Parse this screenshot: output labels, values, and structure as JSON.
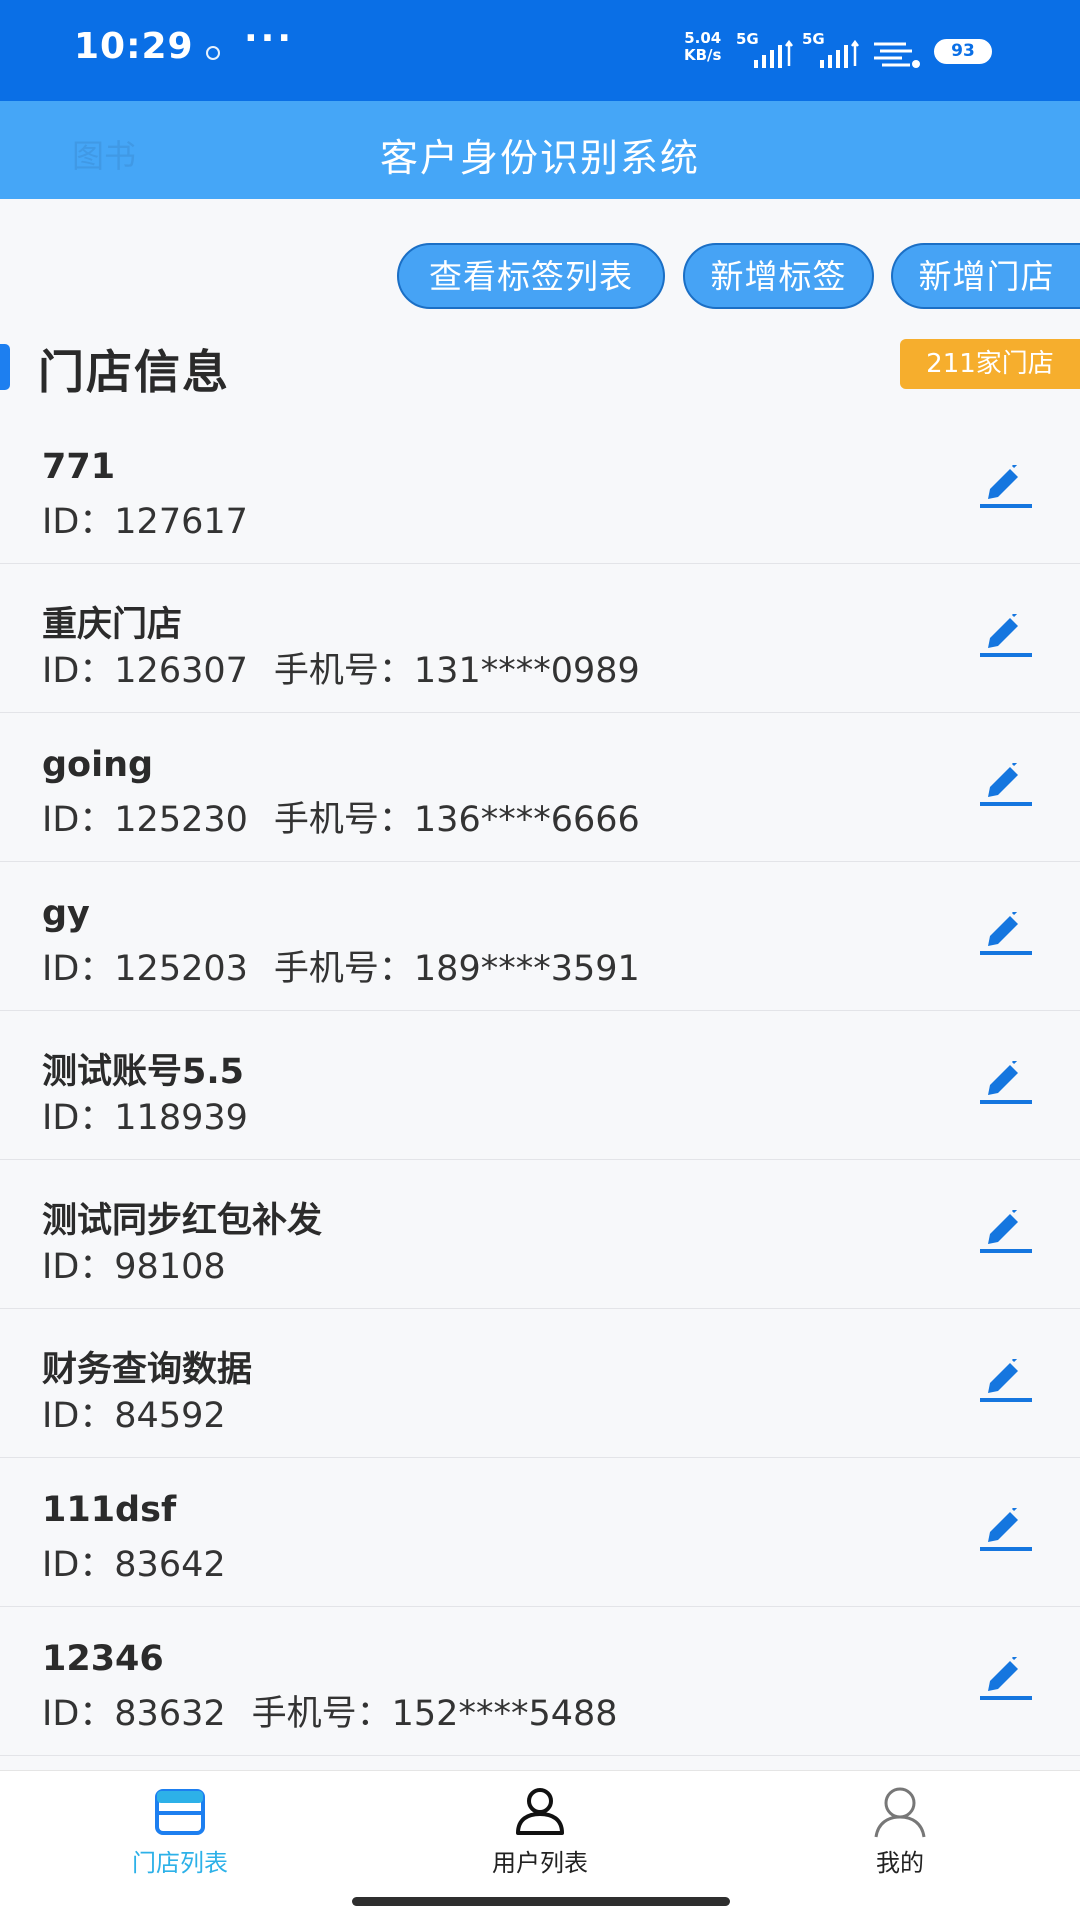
{
  "status_bar": {
    "time": "10:29",
    "more": "···",
    "speed_value": "5.04",
    "speed_unit": "KB/s",
    "signal1_label": "5G",
    "signal2_label": "5G",
    "battery": "93"
  },
  "header": {
    "ghost_text": "图书",
    "title": "客户身份识别系统"
  },
  "actions": {
    "view_tags": "查看标签列表",
    "add_tag": "新增标签",
    "add_store": "新增门店"
  },
  "section": {
    "title": "门店信息",
    "count_badge": "211家门店"
  },
  "labels": {
    "id": "ID：",
    "phone": "手机号："
  },
  "stores": [
    {
      "name": "771",
      "id": "127617",
      "phone": ""
    },
    {
      "name": "重庆门店",
      "id": "126307",
      "phone": "131****0989"
    },
    {
      "name": "going",
      "id": "125230",
      "phone": "136****6666"
    },
    {
      "name": "gy",
      "id": "125203",
      "phone": "189****3591"
    },
    {
      "name": "测试账号5.5",
      "id": "118939",
      "phone": ""
    },
    {
      "name": "测试同步红包补发",
      "id": "98108",
      "phone": ""
    },
    {
      "name": "财务查询数据",
      "id": "84592",
      "phone": ""
    },
    {
      "name": "111dsf",
      "id": "83642",
      "phone": ""
    },
    {
      "name": "12346",
      "id": "83632",
      "phone": "152****5488"
    }
  ],
  "bottom_nav": {
    "store_list": "门店列表",
    "user_list": "用户列表",
    "mine": "我的"
  },
  "colors": {
    "status_bar": "#0a6fe6",
    "header": "#45a6f7",
    "accent": "#1d7ff0",
    "badge": "#f6ae2d",
    "active_nav": "#2db1e8"
  }
}
